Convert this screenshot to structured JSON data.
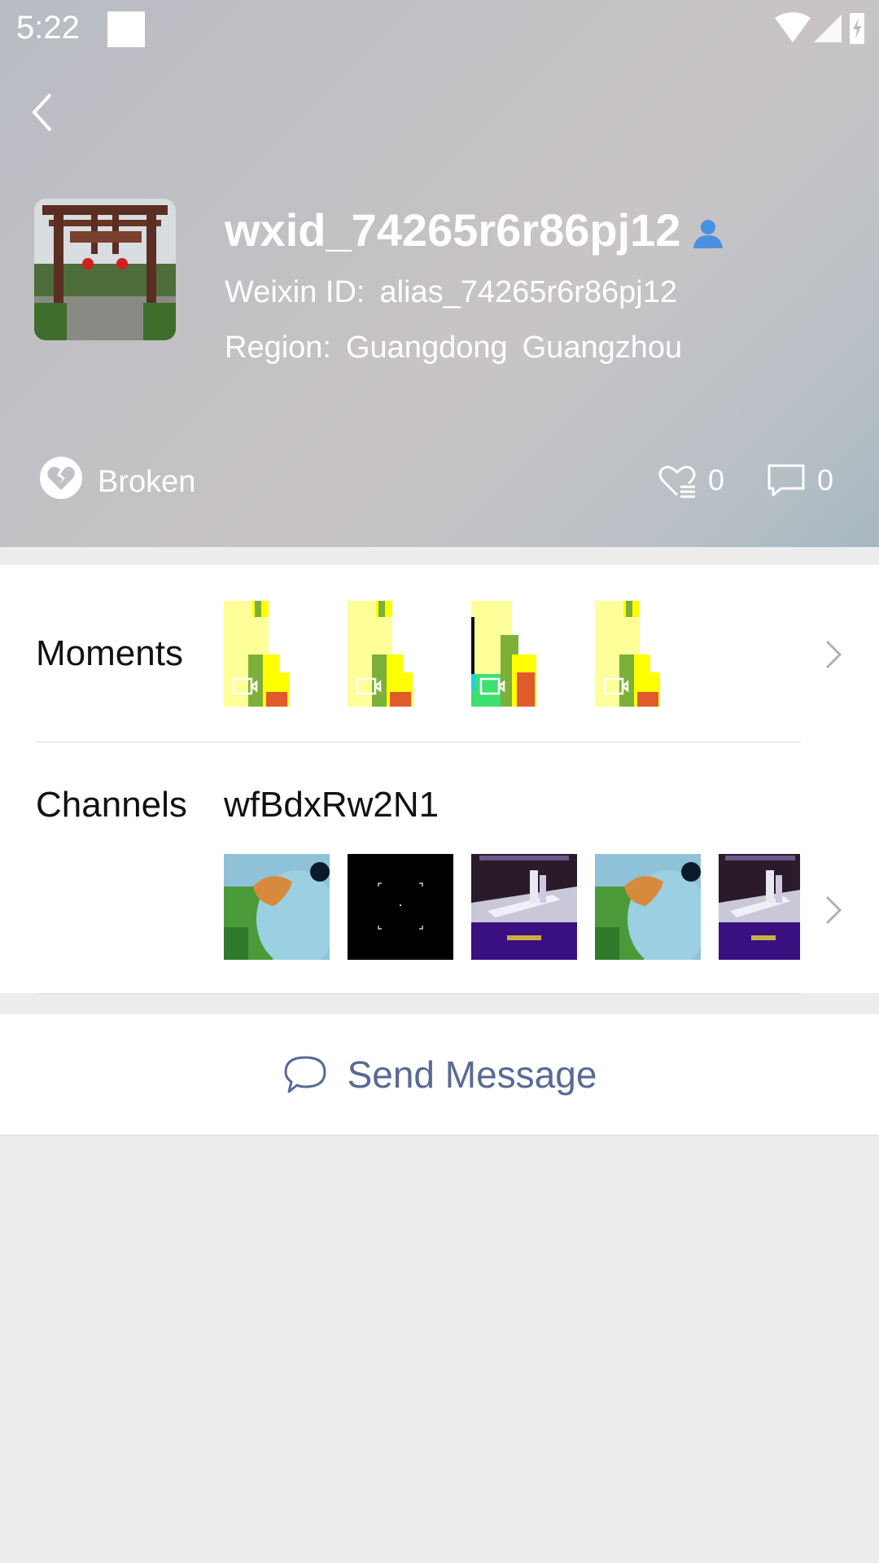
{
  "status_bar": {
    "time": "5:22"
  },
  "profile": {
    "username": "wxid_74265r6r86pj12",
    "weixin_id_label": "Weixin ID:",
    "weixin_id": "alias_74265r6r86pj12",
    "region_label": "Region:",
    "region_province": "Guangdong",
    "region_city": "Guangzhou",
    "status_label": "Broken",
    "likes_count": "0",
    "comments_count": "0"
  },
  "moments": {
    "label": "Moments"
  },
  "channels": {
    "label": "Channels",
    "channel_id": "wfBdxRw2N1"
  },
  "actions": {
    "send_message": "Send Message"
  },
  "colors": {
    "accent_link": "#576b95",
    "badge_blue": "#4a90e2"
  }
}
